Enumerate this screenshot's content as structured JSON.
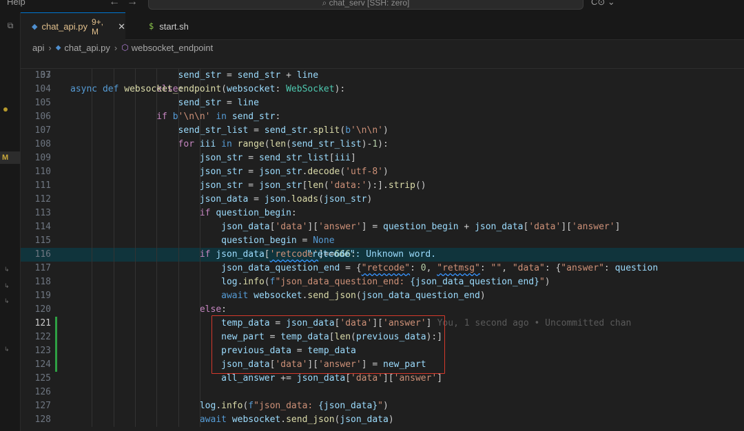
{
  "titlebar": {
    "menu_help": "Help",
    "nav_back": "←",
    "nav_forward": "→",
    "command_center": "⌕ chat_serv [SSH: zero]",
    "account": "C⊙ ⌄"
  },
  "tabs": [
    {
      "icon": "python-icon",
      "name": "chat_api.py",
      "badge": "9+, M",
      "close": "✕"
    },
    {
      "icon": "shell-icon",
      "name": "start.sh"
    }
  ],
  "breadcrumb": {
    "folder": "api",
    "file": "chat_api.py",
    "symbol": "websocket_endpoint"
  },
  "activity": {
    "modified_badge": "M"
  },
  "colors": {
    "editor_bg": "#1f1f1f",
    "highlight_bg": "#10343c",
    "keyword": "#569cd6",
    "control": "#c586c0",
    "function": "#dcdcaa",
    "string": "#ce9178",
    "variable": "#9cdcfe",
    "type": "#4ec9b0",
    "number": "#b5cea8",
    "modified_gutter": "#2ea043",
    "review_box": "#d6392c"
  },
  "editor": {
    "sticky": {
      "ln": "37",
      "code": "async def websocket_endpoint(websocket: WebSocket):"
    },
    "lines": [
      {
        "ln": "103",
        "code": "                    send_str = send_str + line"
      },
      {
        "ln": "104",
        "code": "                else:"
      },
      {
        "ln": "105",
        "code": "                    send_str = line"
      },
      {
        "ln": "106",
        "code": "                if b'\\n\\n' in send_str:"
      },
      {
        "ln": "107",
        "code": "                    send_str_list = send_str.split(b'\\n\\n')"
      },
      {
        "ln": "108",
        "code": "                    for iii in range(len(send_str_list)-1):"
      },
      {
        "ln": "109",
        "code": "                        json_str = send_str_list[iii]"
      },
      {
        "ln": "110",
        "code": "                        json_str = json_str.decode('utf-8')"
      },
      {
        "ln": "111",
        "code": "                        json_str = json_str[len('data:'):].strip()"
      },
      {
        "ln": "112",
        "code": "                        json_data = json.loads(json_str)"
      },
      {
        "ln": "113",
        "code": "                        if question_begin:"
      },
      {
        "ln": "114",
        "code": "                            json_data['data']['answer'] = question_begin + json_data['data']['answer']"
      },
      {
        "ln": "115",
        "code": "                            question_begin = None"
      },
      {
        "ln": "116",
        "code": "                        if json_data['retcode']==666:"
      },
      {
        "ln": "117",
        "code": "                            json_data_question_end = {\"retcode\": 0, \"retmsg\": \"\", \"data\": {\"answer\": question"
      },
      {
        "ln": "118",
        "code": "                            log.info(f\"json_data_question_end: {json_data_question_end}\")"
      },
      {
        "ln": "119",
        "code": "                            await websocket.send_json(json_data_question_end)"
      },
      {
        "ln": "120",
        "code": "                        else:"
      },
      {
        "ln": "121",
        "code": "                            temp_data = json_data['data']['answer']"
      },
      {
        "ln": "122",
        "code": "                            new_part = temp_data[len(previous_data):]"
      },
      {
        "ln": "123",
        "code": "                            previous_data = temp_data"
      },
      {
        "ln": "124",
        "code": "                            json_data['data']['answer'] = new_part"
      },
      {
        "ln": "125",
        "code": "                            all_answer += json_data['data']['answer']"
      },
      {
        "ln": "126",
        "code": ""
      },
      {
        "ln": "127",
        "code": "                        log.info(f\"json_data: {json_data}\")"
      },
      {
        "ln": "128",
        "code": "                        await websocket.send_json(json_data)"
      }
    ],
    "hover_message": "\"retcode\": Unknown word.",
    "blame": "You, 1 second ago • Uncommitted chan"
  }
}
